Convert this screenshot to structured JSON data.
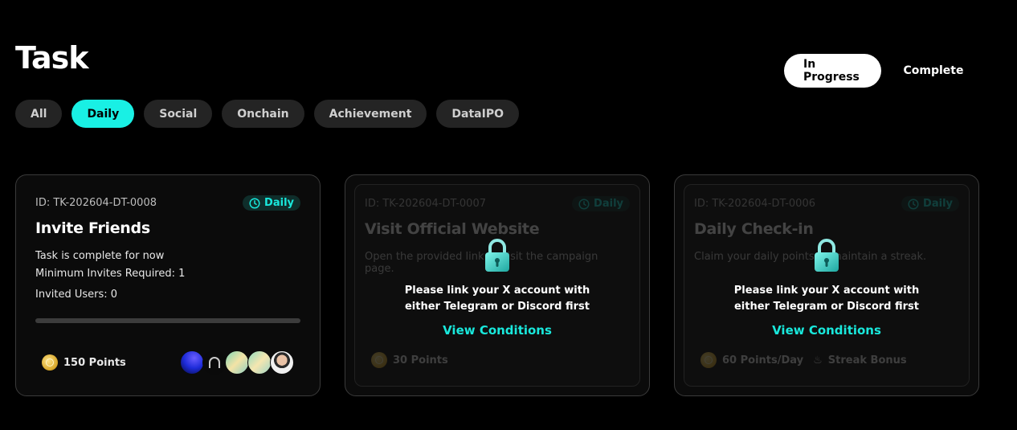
{
  "page": {
    "title": "Task"
  },
  "status_tabs": {
    "in_progress": "In Progress",
    "complete": "Complete"
  },
  "filters": [
    "All",
    "Daily",
    "Social",
    "Onchain",
    "Achievement",
    "DataIPO"
  ],
  "active_filter": "Daily",
  "cards": [
    {
      "id": "ID: TK-202604-DT-0008",
      "badge": "Daily",
      "title": "Invite Friends",
      "status_line": "Task is complete for now",
      "min_invites": "Minimum Invites Required: 1",
      "invited": "Invited Users: 0",
      "progress": 0,
      "points": "150 Points"
    },
    {
      "id": "ID: TK-202604-DT-0007",
      "badge": "Daily",
      "title": "Visit Official Website",
      "description": "Open the provided link to visit the campaign page.",
      "points": "30 Points",
      "lock_message": "Please link your X account with either Telegram or Discord first",
      "lock_link": "View Conditions"
    },
    {
      "id": "ID: TK-202604-DT-0006",
      "badge": "Daily",
      "title": "Daily Check-in",
      "description": "Claim your daily points to maintain a streak.",
      "points": "60 Points/Day",
      "extra": "Streak Bonus",
      "lock_message": "Please link your X account with either Telegram or Discord first",
      "lock_link": "View Conditions"
    }
  ],
  "colors": {
    "accent": "#19f0e4",
    "background": "#000000",
    "chip": "#242424"
  },
  "icons": {
    "badge": "clock-icon",
    "lock": "lock-icon",
    "coin": "coin-icon",
    "streak": "flame-icon"
  }
}
